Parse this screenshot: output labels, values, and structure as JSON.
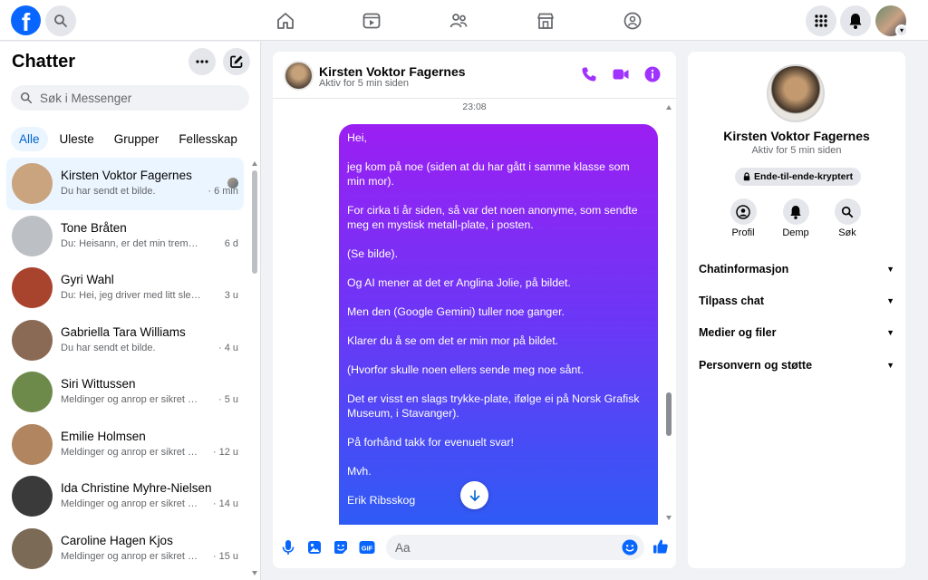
{
  "topnav": {
    "logo_letter": "f",
    "icons": [
      "search-icon",
      "home-icon",
      "video-icon",
      "friends-icon",
      "marketplace-icon",
      "groups-icon",
      "menu-grid-icon",
      "notifications-icon"
    ]
  },
  "sidebar": {
    "title": "Chatter",
    "search_placeholder": "Søk i Messenger",
    "filters": [
      {
        "label": "Alle",
        "active": true
      },
      {
        "label": "Uleste",
        "active": false
      },
      {
        "label": "Grupper",
        "active": false
      },
      {
        "label": "Fellesskap",
        "active": false
      }
    ],
    "chats": [
      {
        "name": "Kirsten Voktor Fagernes",
        "preview": "Du har sendt et bilde.",
        "time": "· 6 min",
        "selected": true,
        "avatar": "#c9a47e"
      },
      {
        "name": "Tone Bråten",
        "preview": "Du: Heisann, er det min tremennin...",
        "time": "6 d",
        "selected": false,
        "avatar": "#bcc0c4"
      },
      {
        "name": "Gyri Wahl",
        "preview": "Du: Hei, jeg driver med litt slektsfo...",
        "time": "3 u",
        "selected": false,
        "avatar": "#a8432d"
      },
      {
        "name": "Gabriella Tara Williams",
        "preview": "Du har sendt et bilde.",
        "time": "· 4 u",
        "selected": false,
        "avatar": "#8a6a55"
      },
      {
        "name": "Siri Wittussen",
        "preview": "Meldinger og anrop er sikret med ...",
        "time": "· 5 u",
        "selected": false,
        "avatar": "#6d8a4a"
      },
      {
        "name": "Emilie Holmsen",
        "preview": "Meldinger og anrop er sikret me...",
        "time": "· 12 u",
        "selected": false,
        "avatar": "#b08560"
      },
      {
        "name": "Ida Christine Myhre-Nielsen",
        "preview": "Meldinger og anrop er sikret me...",
        "time": "· 14 u",
        "selected": false,
        "avatar": "#3a3a3a"
      },
      {
        "name": "Caroline Hagen Kjos",
        "preview": "Meldinger og anrop er sikret me...",
        "time": "· 15 u",
        "selected": false,
        "avatar": "#7b6a55"
      }
    ]
  },
  "conversation": {
    "name": "Kirsten Voktor Fagernes",
    "status": "Aktiv for 5 min siden",
    "timestamp": "23:08",
    "message_paragraphs": [
      "Hei,",
      "jeg kom på noe (siden at du har gått i samme klasse som min mor).",
      "For cirka ti år siden, så var det noen anonyme, som sendte meg en mystisk metall-plate, i posten.",
      "(Se bilde).",
      "Og AI mener at det er Anglina Jolie, på bildet.",
      "Men den (Google Gemini) tuller noe ganger.",
      "Klarer du å se om det er min mor på bildet.",
      "(Hvorfor skulle noen ellers sende meg noe sånt.",
      "Det er visst en slags trykke-plate, ifølge ei på Norsk Grafisk Museum, i Stavanger).",
      "På forhånd takk for evenuelt svar!",
      "Mvh.",
      "Erik Ribsskog"
    ],
    "input_placeholder": "Aa",
    "accent_color": "#a033ff"
  },
  "info_panel": {
    "name": "Kirsten Voktor Fagernes",
    "status": "Aktiv for 5 min siden",
    "encryption_label": "Ende-til-ende-kryptert",
    "actions": [
      {
        "label": "Profil",
        "icon": "profile-icon"
      },
      {
        "label": "Demp",
        "icon": "bell-icon"
      },
      {
        "label": "Søk",
        "icon": "search-icon"
      }
    ],
    "sections": [
      "Chatinformasjon",
      "Tilpass chat",
      "Medier og filer",
      "Personvern og støtte"
    ]
  }
}
